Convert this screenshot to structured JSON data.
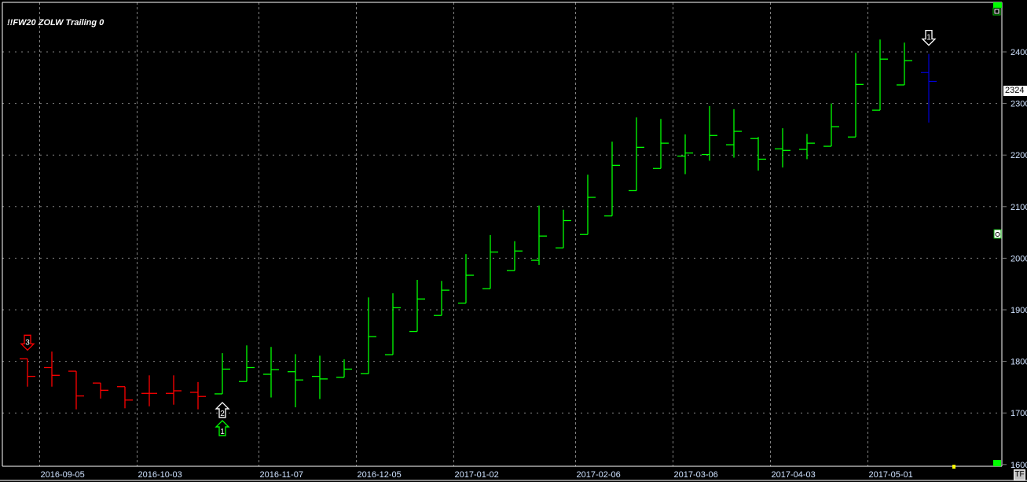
{
  "chart_data": {
    "type": "ohlc",
    "title": "!!FW20 ZOLW Trailing 0",
    "ylim": [
      1600,
      2400
    ],
    "yticks": [
      1600,
      1700,
      1800,
      1900,
      2000,
      2100,
      2200,
      2300,
      2400
    ],
    "last_price_label": "2324",
    "x_labels": [
      {
        "bar": 1,
        "label": "2016-09-05"
      },
      {
        "bar": 5,
        "label": "2016-10-03"
      },
      {
        "bar": 10,
        "label": "2016-11-07"
      },
      {
        "bar": 14,
        "label": "2016-12-05"
      },
      {
        "bar": 18,
        "label": "2017-01-02"
      },
      {
        "bar": 23,
        "label": "2017-02-06"
      },
      {
        "bar": 27,
        "label": "2017-03-06"
      },
      {
        "bar": 31,
        "label": "2017-04-03"
      },
      {
        "bar": 35,
        "label": "2017-05-01"
      }
    ],
    "colors": {
      "down": "#ff0000",
      "up": "#00ff00",
      "current": "#0000ff",
      "grid": "#808080",
      "axis_text": "#cfe2ff"
    },
    "bars": [
      {
        "o": 1805,
        "h": 1805,
        "l": 1751,
        "c": 1771,
        "color": "down"
      },
      {
        "o": 1788,
        "h": 1819,
        "l": 1751,
        "c": 1773,
        "color": "down"
      },
      {
        "o": 1781,
        "h": 1781,
        "l": 1707,
        "c": 1733,
        "color": "down"
      },
      {
        "o": 1758,
        "h": 1758,
        "l": 1728,
        "c": 1744,
        "color": "down"
      },
      {
        "o": 1751,
        "h": 1751,
        "l": 1709,
        "c": 1725,
        "color": "down"
      },
      {
        "o": 1738,
        "h": 1773,
        "l": 1713,
        "c": 1738,
        "color": "down"
      },
      {
        "o": 1738,
        "h": 1773,
        "l": 1716,
        "c": 1743,
        "color": "down"
      },
      {
        "o": 1740,
        "h": 1760,
        "l": 1707,
        "c": 1732,
        "color": "down"
      },
      {
        "o": 1737,
        "h": 1816,
        "l": 1737,
        "c": 1785,
        "color": "up"
      },
      {
        "o": 1761,
        "h": 1831,
        "l": 1761,
        "c": 1788,
        "color": "up"
      },
      {
        "o": 1775,
        "h": 1828,
        "l": 1730,
        "c": 1784,
        "color": "up"
      },
      {
        "o": 1780,
        "h": 1814,
        "l": 1711,
        "c": 1764,
        "color": "up"
      },
      {
        "o": 1771,
        "h": 1811,
        "l": 1727,
        "c": 1766,
        "color": "up"
      },
      {
        "o": 1769,
        "h": 1804,
        "l": 1769,
        "c": 1785,
        "color": "up"
      },
      {
        "o": 1776,
        "h": 1924,
        "l": 1776,
        "c": 1848,
        "color": "up"
      },
      {
        "o": 1813,
        "h": 1932,
        "l": 1813,
        "c": 1904,
        "color": "up"
      },
      {
        "o": 1858,
        "h": 1958,
        "l": 1858,
        "c": 1921,
        "color": "up"
      },
      {
        "o": 1889,
        "h": 1956,
        "l": 1889,
        "c": 1938,
        "color": "up"
      },
      {
        "o": 1913,
        "h": 2008,
        "l": 1913,
        "c": 1967,
        "color": "up"
      },
      {
        "o": 1941,
        "h": 2045,
        "l": 1941,
        "c": 2012,
        "color": "up"
      },
      {
        "o": 1976,
        "h": 2033,
        "l": 1976,
        "c": 2014,
        "color": "up"
      },
      {
        "o": 1996,
        "h": 2102,
        "l": 1987,
        "c": 2043,
        "color": "up"
      },
      {
        "o": 2020,
        "h": 2094,
        "l": 2020,
        "c": 2073,
        "color": "up"
      },
      {
        "o": 2046,
        "h": 2162,
        "l": 2046,
        "c": 2118,
        "color": "up"
      },
      {
        "o": 2082,
        "h": 2226,
        "l": 2082,
        "c": 2180,
        "color": "up"
      },
      {
        "o": 2131,
        "h": 2273,
        "l": 2131,
        "c": 2215,
        "color": "up"
      },
      {
        "o": 2174,
        "h": 2270,
        "l": 2174,
        "c": 2223,
        "color": "up"
      },
      {
        "o": 2198,
        "h": 2240,
        "l": 2163,
        "c": 2204,
        "color": "up"
      },
      {
        "o": 2201,
        "h": 2295,
        "l": 2189,
        "c": 2238,
        "color": "up"
      },
      {
        "o": 2220,
        "h": 2289,
        "l": 2195,
        "c": 2246,
        "color": "up"
      },
      {
        "o": 2232,
        "h": 2235,
        "l": 2170,
        "c": 2192,
        "color": "up"
      },
      {
        "o": 2212,
        "h": 2252,
        "l": 2176,
        "c": 2209,
        "color": "up"
      },
      {
        "o": 2211,
        "h": 2241,
        "l": 2192,
        "c": 2223,
        "color": "up"
      },
      {
        "o": 2217,
        "h": 2300,
        "l": 2217,
        "c": 2255,
        "color": "up"
      },
      {
        "o": 2235,
        "h": 2398,
        "l": 2235,
        "c": 2337,
        "color": "up"
      },
      {
        "o": 2287,
        "h": 2424,
        "l": 2287,
        "c": 2386,
        "color": "up"
      },
      {
        "o": 2336,
        "h": 2418,
        "l": 2336,
        "c": 2383,
        "color": "up"
      },
      {
        "o": 2360,
        "h": 2396,
        "l": 2263,
        "c": 2343,
        "color": "current"
      }
    ],
    "signals": [
      {
        "bar": 0,
        "dir": "down",
        "label": "3",
        "color": "#ff0000",
        "pos": "above"
      },
      {
        "bar": 8,
        "dir": "up",
        "label": "2",
        "color": "#ffffff",
        "pos": "below"
      },
      {
        "bar": 8,
        "dir": "up",
        "label": "1",
        "color": "#00ff00",
        "pos": "below2"
      },
      {
        "bar": 37,
        "dir": "down",
        "label": "1",
        "color": "#ffffff",
        "pos": "above"
      }
    ]
  },
  "ui": {
    "tf_label": "TF"
  }
}
